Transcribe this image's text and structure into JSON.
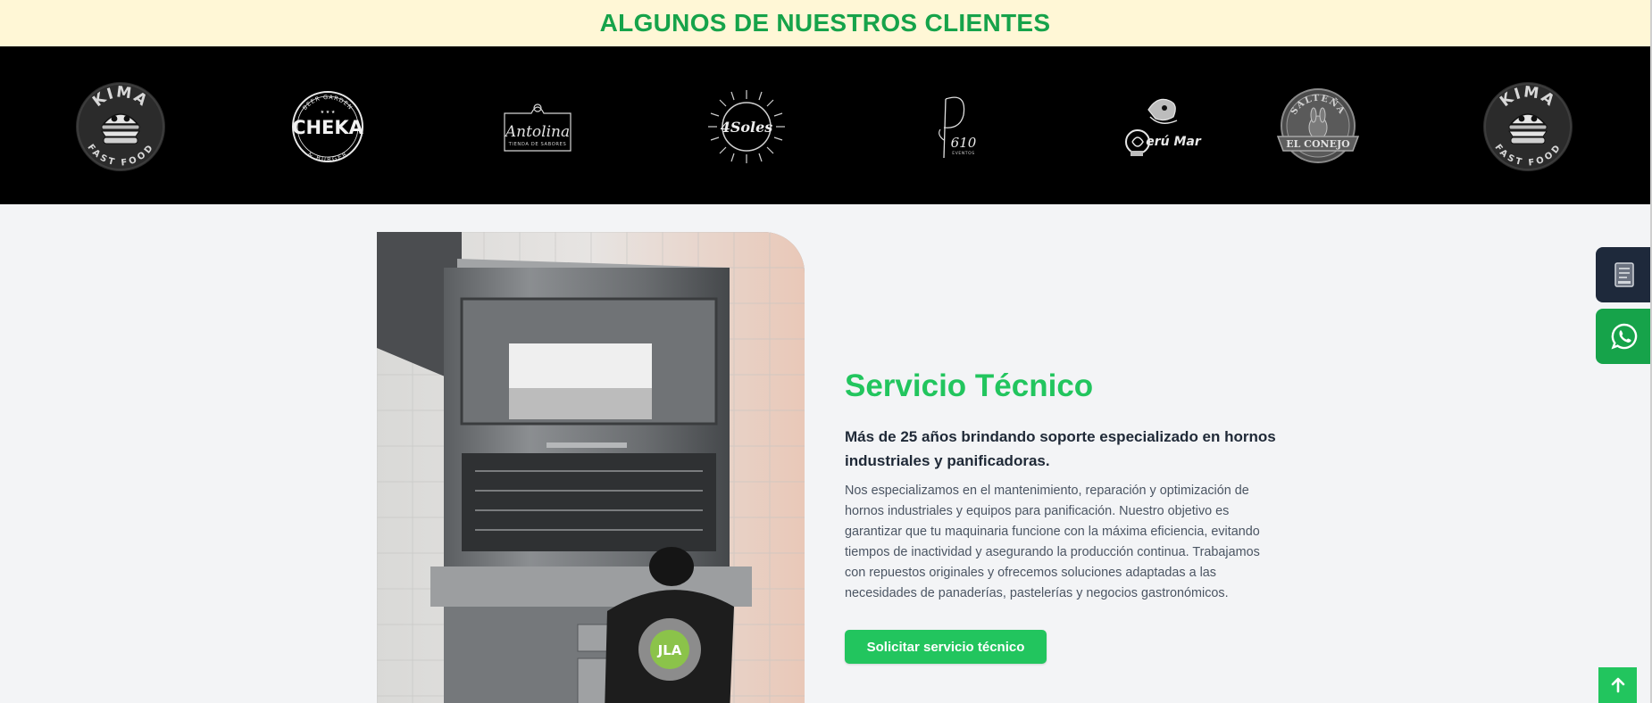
{
  "clients": {
    "heading": "ALGUNOS DE NUESTROS CLIENTES",
    "logos": [
      {
        "name": "Kima Fast Food",
        "top_text": "KIMA",
        "bottom_text": "FAST FOOD"
      },
      {
        "name": "Cheka Beer Garden & Burger",
        "top_text": "BEER GARDEN",
        "main_text": "CHEKA",
        "bottom_text": "& BURGER"
      },
      {
        "name": "Antolina Tienda de Sabores",
        "main_text": "Antolina",
        "bottom_text": "TIENDA DE SABORES"
      },
      {
        "name": "4Soles",
        "main_text": "4Soles"
      },
      {
        "name": "610 Eventos",
        "main_text": "610",
        "bottom_text": "EVENTOS"
      },
      {
        "name": "Perú Mar",
        "main_text": "erú Mar"
      },
      {
        "name": "Salteña El Conejo",
        "top_text": "SALTEÑA",
        "bottom_text": "EL CONEJO"
      },
      {
        "name": "Kima Fast Food",
        "top_text": "KIMA",
        "bottom_text": "FAST FOOD"
      }
    ]
  },
  "service": {
    "photo_badge": "JLA",
    "title": "Servicio Técnico",
    "subtitle": "Más de 25 años brindando soporte especializado en hornos industriales y panificadoras.",
    "body": "Nos especializamos en el mantenimiento, reparación y optimización de hornos industriales y equipos para panificación. Nuestro objetivo es garantizar que tu maquinaria funcione con la máxima eficiencia, evitando tiempos de inactividad y asegurando la producción continua. Trabajamos con repuestos originales y ofrecemos soluciones adaptadas a las necesidades de panaderías, pastelerías y negocios gastronómicos.",
    "cta_label": "Solicitar servicio técnico"
  },
  "floating": {
    "catalog_icon": "catalog-book-icon",
    "whatsapp_icon": "whatsapp-icon",
    "back_to_top_icon": "arrow-up-icon"
  },
  "colors": {
    "accent_green": "#22c55e",
    "heading_green": "#16a34a",
    "header_band": "#fff7d6",
    "logo_strip": "#000000",
    "catalog_button": "#1e293b"
  }
}
